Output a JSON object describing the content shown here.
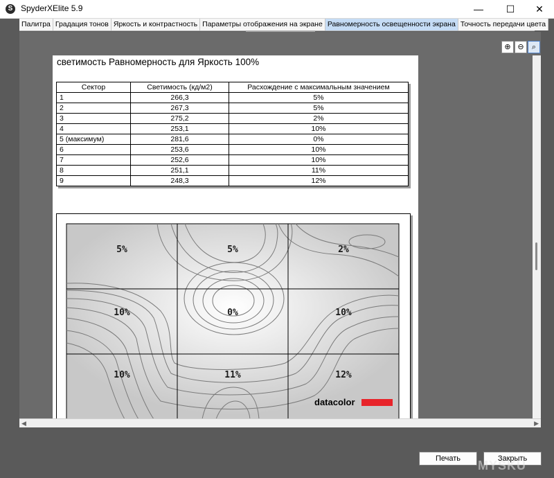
{
  "window": {
    "title": "SpyderXElite 5.9",
    "icon": "S",
    "controls": {
      "minimize": "—",
      "maximize": "☐",
      "close": "✕"
    }
  },
  "tabs": [
    {
      "label": "Палитра",
      "active": false
    },
    {
      "label": "Градация тонов",
      "active": false
    },
    {
      "label": "Яркость и контрастность",
      "active": false
    },
    {
      "label": "Параметры отображения на экране",
      "active": false
    },
    {
      "label": "Равномерность освещенности экрана",
      "active": true
    },
    {
      "label": "Точность передачи цвета",
      "active": false
    }
  ],
  "zoom": {
    "zoom_in": "⊕",
    "zoom_out": "⊖",
    "zoom_fit": "⌕"
  },
  "report": {
    "title": "светимость Равномерность для Яркость 100%",
    "table": {
      "headers": [
        "Сектор",
        "Светимость (кд/м2)",
        "Расхождение с максимальным значением"
      ],
      "rows": [
        [
          "1",
          "266,3",
          "5%"
        ],
        [
          "2",
          "267,3",
          "5%"
        ],
        [
          "3",
          "275,2",
          "2%"
        ],
        [
          "4",
          "253,1",
          "10%"
        ],
        [
          "5 (максимум)",
          "281,6",
          "0%"
        ],
        [
          "6",
          "253,6",
          "10%"
        ],
        [
          "7",
          "252,6",
          "10%"
        ],
        [
          "8",
          "251,1",
          "11%"
        ],
        [
          "9",
          "248,3",
          "12%"
        ]
      ]
    },
    "contour": {
      "cells": [
        "5%",
        "5%",
        "2%",
        "10%",
        "0%",
        "10%",
        "10%",
        "11%",
        "12%"
      ],
      "logo": "datacolor",
      "logo_bar_color": "#e8242a"
    }
  },
  "footer": {
    "print": "Печать",
    "close": "Закрыть"
  },
  "watermark": "MYSKU"
}
